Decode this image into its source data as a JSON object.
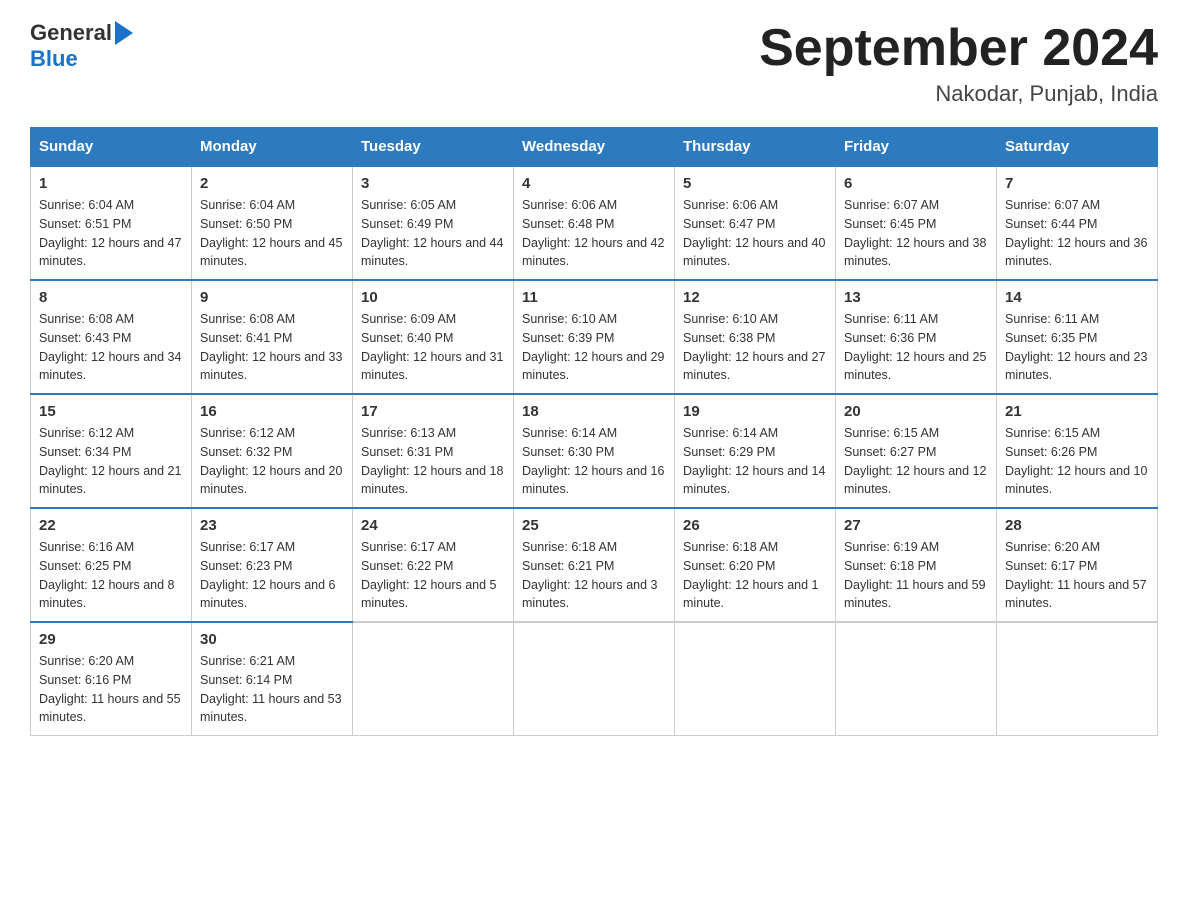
{
  "header": {
    "logo_general": "General",
    "logo_blue": "Blue",
    "title": "September 2024",
    "subtitle": "Nakodar, Punjab, India"
  },
  "weekdays": [
    "Sunday",
    "Monday",
    "Tuesday",
    "Wednesday",
    "Thursday",
    "Friday",
    "Saturday"
  ],
  "weeks": [
    [
      {
        "day": "1",
        "sunrise": "6:04 AM",
        "sunset": "6:51 PM",
        "daylight": "12 hours and 47 minutes."
      },
      {
        "day": "2",
        "sunrise": "6:04 AM",
        "sunset": "6:50 PM",
        "daylight": "12 hours and 45 minutes."
      },
      {
        "day": "3",
        "sunrise": "6:05 AM",
        "sunset": "6:49 PM",
        "daylight": "12 hours and 44 minutes."
      },
      {
        "day": "4",
        "sunrise": "6:06 AM",
        "sunset": "6:48 PM",
        "daylight": "12 hours and 42 minutes."
      },
      {
        "day": "5",
        "sunrise": "6:06 AM",
        "sunset": "6:47 PM",
        "daylight": "12 hours and 40 minutes."
      },
      {
        "day": "6",
        "sunrise": "6:07 AM",
        "sunset": "6:45 PM",
        "daylight": "12 hours and 38 minutes."
      },
      {
        "day": "7",
        "sunrise": "6:07 AM",
        "sunset": "6:44 PM",
        "daylight": "12 hours and 36 minutes."
      }
    ],
    [
      {
        "day": "8",
        "sunrise": "6:08 AM",
        "sunset": "6:43 PM",
        "daylight": "12 hours and 34 minutes."
      },
      {
        "day": "9",
        "sunrise": "6:08 AM",
        "sunset": "6:41 PM",
        "daylight": "12 hours and 33 minutes."
      },
      {
        "day": "10",
        "sunrise": "6:09 AM",
        "sunset": "6:40 PM",
        "daylight": "12 hours and 31 minutes."
      },
      {
        "day": "11",
        "sunrise": "6:10 AM",
        "sunset": "6:39 PM",
        "daylight": "12 hours and 29 minutes."
      },
      {
        "day": "12",
        "sunrise": "6:10 AM",
        "sunset": "6:38 PM",
        "daylight": "12 hours and 27 minutes."
      },
      {
        "day": "13",
        "sunrise": "6:11 AM",
        "sunset": "6:36 PM",
        "daylight": "12 hours and 25 minutes."
      },
      {
        "day": "14",
        "sunrise": "6:11 AM",
        "sunset": "6:35 PM",
        "daylight": "12 hours and 23 minutes."
      }
    ],
    [
      {
        "day": "15",
        "sunrise": "6:12 AM",
        "sunset": "6:34 PM",
        "daylight": "12 hours and 21 minutes."
      },
      {
        "day": "16",
        "sunrise": "6:12 AM",
        "sunset": "6:32 PM",
        "daylight": "12 hours and 20 minutes."
      },
      {
        "day": "17",
        "sunrise": "6:13 AM",
        "sunset": "6:31 PM",
        "daylight": "12 hours and 18 minutes."
      },
      {
        "day": "18",
        "sunrise": "6:14 AM",
        "sunset": "6:30 PM",
        "daylight": "12 hours and 16 minutes."
      },
      {
        "day": "19",
        "sunrise": "6:14 AM",
        "sunset": "6:29 PM",
        "daylight": "12 hours and 14 minutes."
      },
      {
        "day": "20",
        "sunrise": "6:15 AM",
        "sunset": "6:27 PM",
        "daylight": "12 hours and 12 minutes."
      },
      {
        "day": "21",
        "sunrise": "6:15 AM",
        "sunset": "6:26 PM",
        "daylight": "12 hours and 10 minutes."
      }
    ],
    [
      {
        "day": "22",
        "sunrise": "6:16 AM",
        "sunset": "6:25 PM",
        "daylight": "12 hours and 8 minutes."
      },
      {
        "day": "23",
        "sunrise": "6:17 AM",
        "sunset": "6:23 PM",
        "daylight": "12 hours and 6 minutes."
      },
      {
        "day": "24",
        "sunrise": "6:17 AM",
        "sunset": "6:22 PM",
        "daylight": "12 hours and 5 minutes."
      },
      {
        "day": "25",
        "sunrise": "6:18 AM",
        "sunset": "6:21 PM",
        "daylight": "12 hours and 3 minutes."
      },
      {
        "day": "26",
        "sunrise": "6:18 AM",
        "sunset": "6:20 PM",
        "daylight": "12 hours and 1 minute."
      },
      {
        "day": "27",
        "sunrise": "6:19 AM",
        "sunset": "6:18 PM",
        "daylight": "11 hours and 59 minutes."
      },
      {
        "day": "28",
        "sunrise": "6:20 AM",
        "sunset": "6:17 PM",
        "daylight": "11 hours and 57 minutes."
      }
    ],
    [
      {
        "day": "29",
        "sunrise": "6:20 AM",
        "sunset": "6:16 PM",
        "daylight": "11 hours and 55 minutes."
      },
      {
        "day": "30",
        "sunrise": "6:21 AM",
        "sunset": "6:14 PM",
        "daylight": "11 hours and 53 minutes."
      },
      null,
      null,
      null,
      null,
      null
    ]
  ]
}
